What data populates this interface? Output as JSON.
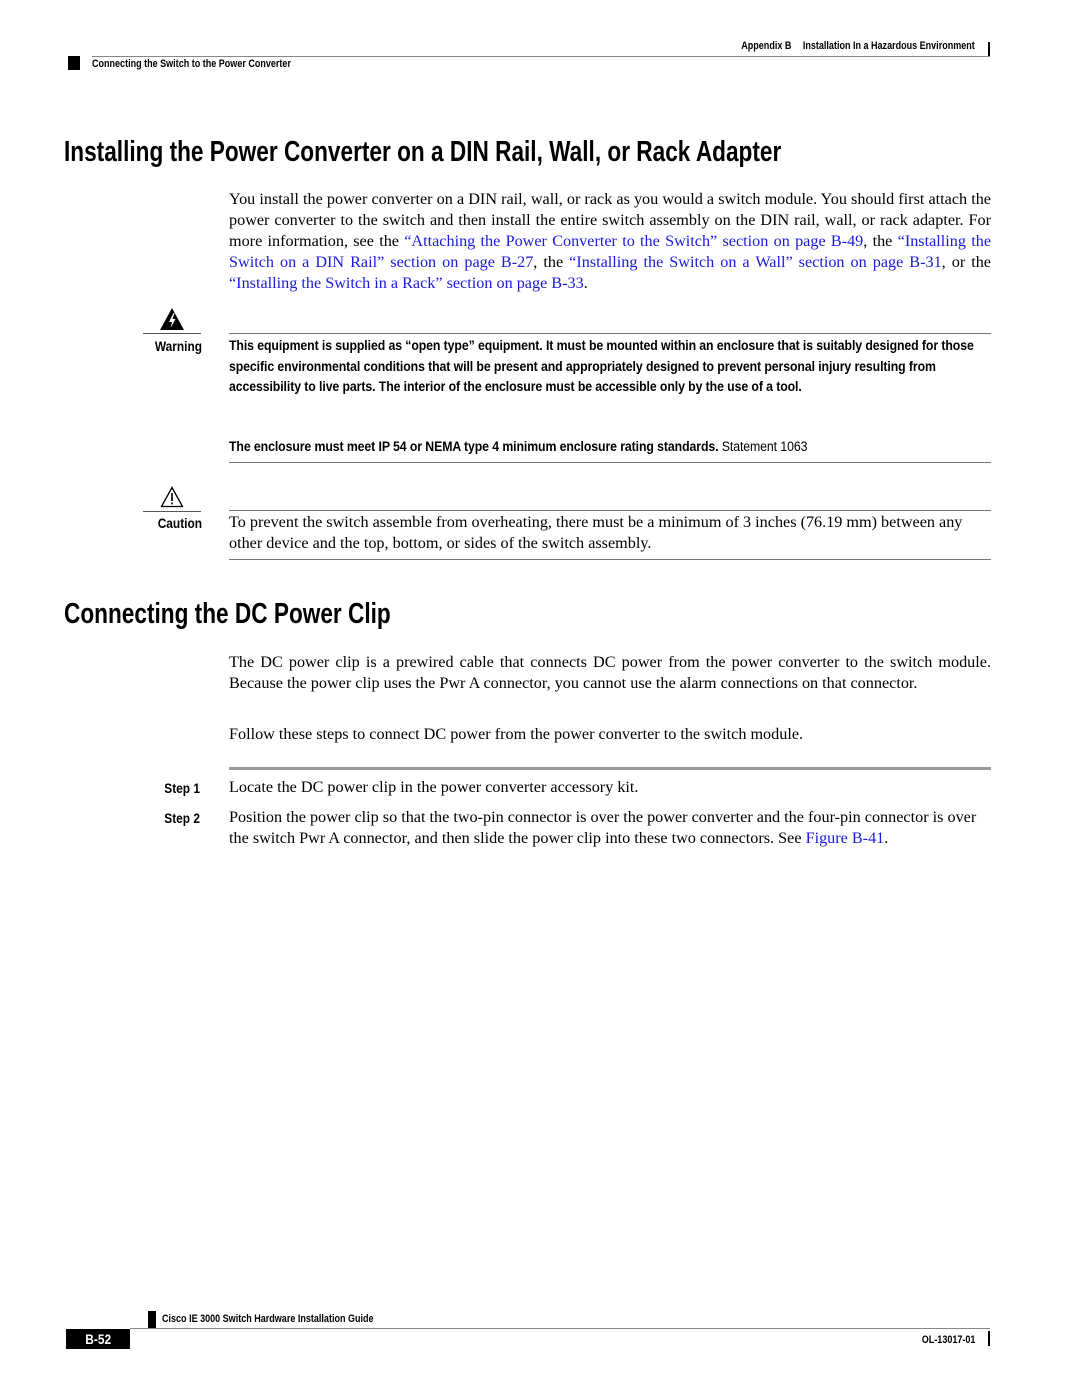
{
  "header": {
    "appendix": "Appendix B",
    "chapter": "Installation In a Hazardous Environment",
    "section": "Connecting the Switch to the Power Converter"
  },
  "section1": {
    "title": "Installing the Power Converter on a DIN Rail, Wall, or Rack Adapter",
    "intro_1": "You install the power converter on a DIN rail, wall, or rack as you would a switch module. You should first attach the power converter to the switch and then install the entire switch assembly on the DIN rail, wall, or rack adapter. For more information, see the ",
    "link_1": "“Attaching the Power Converter to the Switch” section on page B-49",
    "intro_2": ", the ",
    "link_2": "“Installing the Switch on a DIN Rail” section on page B-27",
    "intro_3": ", the ",
    "link_3": "“Installing the Switch on a Wall” section on page B-31",
    "intro_4": ", or the ",
    "link_4": "“Installing the Switch in a Rack” section on page B-33",
    "intro_5": ".",
    "warning": {
      "label": "Warning",
      "icon": "warning-shock-icon",
      "text": "This equipment is supplied as “open type” equipment. It must be mounted within an enclosure that is suitably designed for those specific environmental conditions that will be present and appropriately designed to prevent personal injury resulting from accessibility to live parts. The interior of the enclosure must be accessible only by the use of a tool.",
      "text2_bold": "The enclosure must meet IP 54 or NEMA type 4 minimum enclosure rating standards.",
      "statement": " Statement 1063"
    },
    "caution": {
      "label": "Caution",
      "icon": "caution-icon",
      "text": "To prevent the switch assemble from overheating, there must be a minimum of 3 inches (76.19 mm) between any other device and the top, bottom, or sides of the switch assembly."
    }
  },
  "section2": {
    "title": "Connecting the DC Power Clip",
    "para1": "The DC power clip is a prewired cable that connects DC power from the power converter to the switch module. Because the power clip uses the Pwr A connector, you cannot use the alarm connections on that connector.",
    "para2": "Follow these steps to connect DC power from the power converter to the switch module.",
    "steps": [
      {
        "label": "Step 1",
        "text": "Locate the DC power clip in the power converter accessory kit."
      },
      {
        "label": "Step 2",
        "text": "Position the power clip so that the two-pin connector is over the power converter and the four-pin connector is over the switch Pwr A connector, and then slide the power clip into these two connectors. See ",
        "link": "Figure B-41",
        "tail": "."
      }
    ]
  },
  "footer": {
    "guide_title": "Cisco IE 3000 Switch Hardware Installation Guide",
    "page_number": "B-52",
    "doc_number": "OL-13017-01"
  },
  "colors": {
    "link": "#1a1adb",
    "rule": "#888888"
  }
}
